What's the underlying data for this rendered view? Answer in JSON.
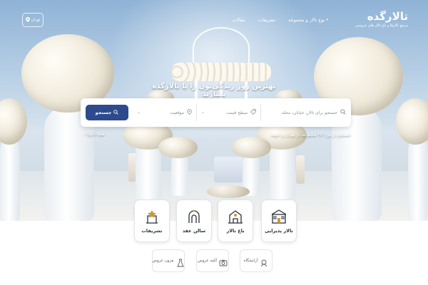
{
  "nav": {
    "logo": "تالارگده",
    "logo_sub": "مرجع تالارها و باغ تالار های عروسی",
    "links": [
      "نوع تالار و مجموعه",
      "تشریفات",
      "مقالات"
    ],
    "city": "تهران"
  },
  "hero": {
    "headline": "بهترین روز زندگی‌تون را با تالارگده بسازید"
  },
  "search": {
    "query_placeholder": "جستجو برای تالار، خیابان، محله",
    "price_label": "سطح قیمت",
    "location_label": "موقعیت",
    "button_label": "جستجو"
  },
  "trending": {
    "text": "جستجو در بین ۳۷۲ مجموعه در تهران و حومه",
    "link": "همه تالارها"
  },
  "categories": [
    {
      "label": "تالار پذیرایی",
      "icon": "wedding-hall-icon"
    },
    {
      "label": "باغ تالار",
      "icon": "garden-hall-icon"
    },
    {
      "label": "سالن عقد",
      "icon": "ceremony-hall-icon"
    },
    {
      "label": "تشریفات",
      "icon": "decoration-icon"
    }
  ],
  "services": [
    {
      "label": "آرایشگاه",
      "icon": "salon-icon"
    },
    {
      "label": "آتلیه عروس",
      "icon": "camera-icon"
    },
    {
      "label": "مزون عروس",
      "icon": "dress-icon"
    }
  ],
  "colors": {
    "primary": "#2e4a8c",
    "accent": "#c79a3b"
  }
}
